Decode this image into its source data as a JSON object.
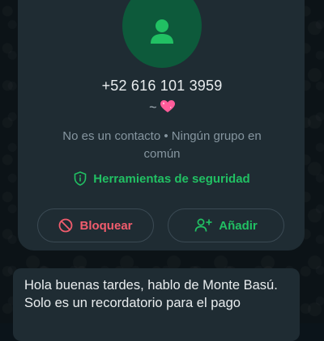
{
  "contact": {
    "phone": "+52 616 101 3959",
    "about_prefix": "~",
    "about_emoji": "sparkling-heart-emoji",
    "meta": "No es un contacto • Ningún grupo en común"
  },
  "security": {
    "label": "Herramientas de seguridad",
    "icon": "shield-icon"
  },
  "actions": {
    "block_label": "Bloquear",
    "add_label": "Añadir"
  },
  "message": {
    "line1": "Hola buenas tardes, hablo de Monte Basú.",
    "line2": "Solo es un recordatorio para el pago"
  },
  "colors": {
    "background": "#0b141a",
    "card": "#1f2c33",
    "accent_green": "#21c063",
    "danger_red": "#f15c6d",
    "avatar_bg": "#0d5a3b"
  }
}
